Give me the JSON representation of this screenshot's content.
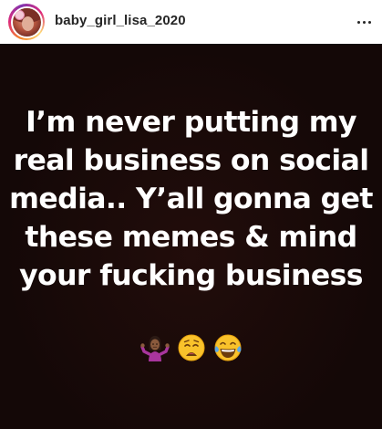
{
  "post": {
    "username": "baby_girl_lisa_2020",
    "more_label": "•••",
    "caption_lines": [
      "I’m never putting my",
      "real business on social",
      "media.. Y’all gonna get",
      "these memes & mind",
      "your fucking business"
    ],
    "emojis": [
      "shrugging-woman-emoji",
      "weary-face-emoji",
      "tears-of-joy-emoji"
    ]
  },
  "colors": {
    "header_bg": "#ffffff",
    "username": "#262626",
    "image_bg": "#140807",
    "meme_text": "#ffffff",
    "story_ring": [
      "#f58529",
      "#dd2a7b",
      "#8134af"
    ]
  }
}
